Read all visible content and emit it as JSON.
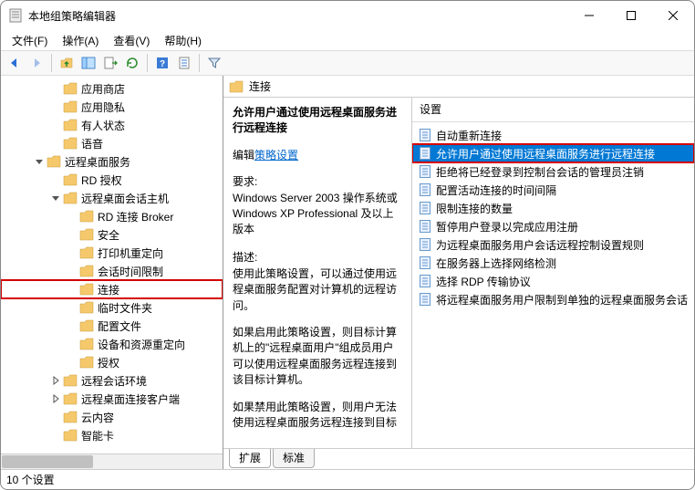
{
  "window": {
    "title": "本地组策略编辑器"
  },
  "menu": {
    "file": "文件(F)",
    "action": "操作(A)",
    "view": "查看(V)",
    "help": "帮助(H)"
  },
  "tree": {
    "items": [
      {
        "indent": 3,
        "label": "应用商店",
        "twisty": ""
      },
      {
        "indent": 3,
        "label": "应用隐私",
        "twisty": ""
      },
      {
        "indent": 3,
        "label": "有人状态",
        "twisty": ""
      },
      {
        "indent": 3,
        "label": "语音",
        "twisty": ""
      },
      {
        "indent": 2,
        "label": "远程桌面服务",
        "twisty": "open"
      },
      {
        "indent": 3,
        "label": "RD 授权",
        "twisty": ""
      },
      {
        "indent": 3,
        "label": "远程桌面会话主机",
        "twisty": "open"
      },
      {
        "indent": 4,
        "label": "RD 连接 Broker",
        "twisty": ""
      },
      {
        "indent": 4,
        "label": "安全",
        "twisty": ""
      },
      {
        "indent": 4,
        "label": "打印机重定向",
        "twisty": ""
      },
      {
        "indent": 4,
        "label": "会话时间限制",
        "twisty": ""
      },
      {
        "indent": 4,
        "label": "连接",
        "twisty": "",
        "highlight": true
      },
      {
        "indent": 4,
        "label": "临时文件夹",
        "twisty": ""
      },
      {
        "indent": 4,
        "label": "配置文件",
        "twisty": ""
      },
      {
        "indent": 4,
        "label": "设备和资源重定向",
        "twisty": ""
      },
      {
        "indent": 4,
        "label": "授权",
        "twisty": ""
      },
      {
        "indent": 3,
        "label": "远程会话环境",
        "twisty": "closed"
      },
      {
        "indent": 3,
        "label": "远程桌面连接客户端",
        "twisty": "closed"
      },
      {
        "indent": 3,
        "label": "云内容",
        "twisty": ""
      },
      {
        "indent": 3,
        "label": "智能卡",
        "twisty": ""
      }
    ]
  },
  "right": {
    "header": "连接",
    "desc": {
      "title": "允许用户通过使用远程桌面服务进行远程连接",
      "edit_label": "编辑",
      "edit_link": "策略设置",
      "req_h": "要求:",
      "req_p": "Windows Server 2003 操作系统或 Windows XP Professional 及以上版本",
      "desc_h": "描述:",
      "desc_p1": "使用此策略设置，可以通过使用远程桌面服务配置对计算机的远程访问。",
      "desc_p2": "如果启用此策略设置，则目标计算机上的\"远程桌面用户\"组成员用户可以使用远程桌面服务远程连接到该目标计算机。",
      "desc_p3": "如果禁用此策略设置，则用户无法使用远程桌面服务远程连接到目标"
    },
    "settings_header": "设置",
    "settings": [
      {
        "label": "自动重新连接"
      },
      {
        "label": "允许用户通过使用远程桌面服务进行远程连接",
        "selected": true,
        "boxed": true
      },
      {
        "label": "拒绝将已经登录到控制台会话的管理员注销"
      },
      {
        "label": "配置活动连接的时间间隔"
      },
      {
        "label": "限制连接的数量"
      },
      {
        "label": "暂停用户登录以完成应用注册"
      },
      {
        "label": "为远程桌面服务用户会话远程控制设置规则"
      },
      {
        "label": "在服务器上选择网络检测"
      },
      {
        "label": "选择 RDP 传输协议"
      },
      {
        "label": "将远程桌面服务用户限制到单独的远程桌面服务会话"
      }
    ]
  },
  "tabs": {
    "extended": "扩展",
    "standard": "标准"
  },
  "status": "10 个设置"
}
